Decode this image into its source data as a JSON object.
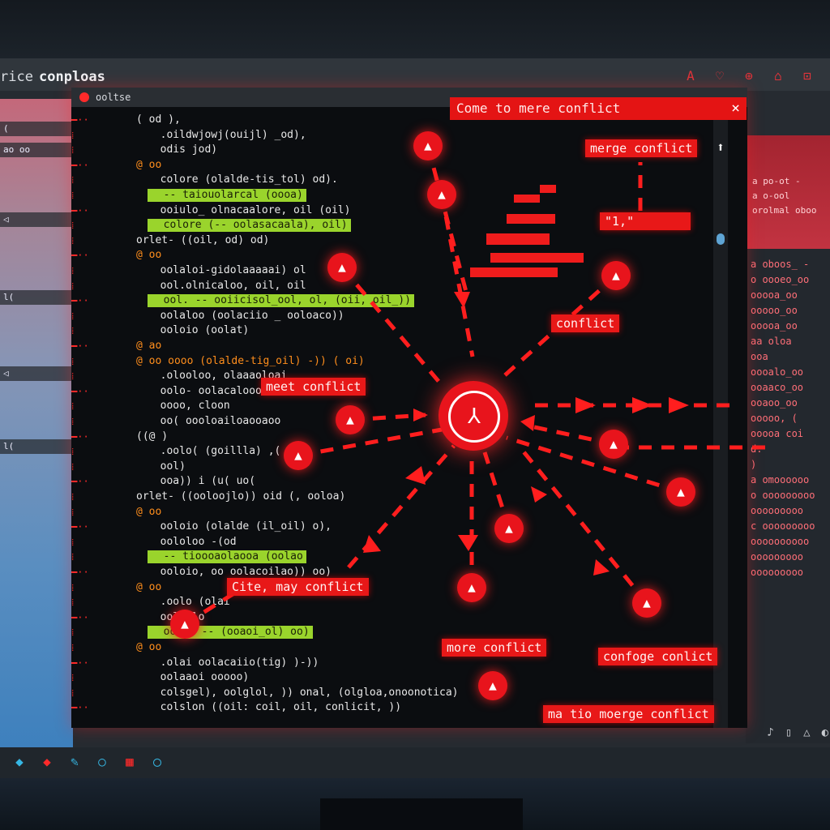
{
  "app": {
    "title_left": "rice",
    "title_main": "conploas"
  },
  "window_controls": [
    "A",
    "♡",
    "⊕",
    "⌂",
    "⊡"
  ],
  "editor": {
    "tab_title": "ooltse"
  },
  "banner": {
    "text": "Come to mere conflict",
    "close_label": "×"
  },
  "labels": {
    "merge_conflict_top": "merge conflict",
    "small_box": "\"1,\"",
    "conflict": "conflict",
    "meet_conflict": "meet conflict",
    "cite_conflict": "Cite, may conflict",
    "more_conflict": "more conflict",
    "confoge_conflict": "confoge conlict",
    "bottom_conflict": "ma tio moerge conflict"
  },
  "code_lines": [
    "( od ),",
    "  .oildwjowj(ouijl) _od),",
    "  odis jod)",
    "@ oo",
    "  colore (olalde-tis_tol) od).",
    "  -- taiouolarcal (oooa)",
    "  ooiulo_ olnacaalore, oil (oil)",
    "  colore (-- oolasacaala), oil)",
    "orlet- ((oil, od) od)",
    "@ oo",
    "  oolaloi-gidolaaaaai) ol",
    "  ool.olnicaloo, oil, oil",
    "  ool. -- ooiicisol_ool, ol, (oii, oil_))",
    "  oolaloo (oolaciio _ ooloaco))",
    "  ooloio (oolat)",
    "@ ao",
    "@ oo oooo (olalde-tig_oil) -)) ( oi)",
    "  .olooloo, olaaaoloai",
    "  oolo- oolacaloooa",
    "  oooo, cloon",
    "  oo( oooloailoaooaoo",
    "((@ )",
    "  .oolo( (goillla) ,(",
    "  ool)",
    "  ooa)) i (u( uo(",
    "orlet- ((ooloojlo)) oid (, ooloa)",
    "@ oo",
    "  ooloio (olalde (il_oil) o),",
    "  oololoo -(od",
    "  -- tioooaolaooa (oolao",
    "  ooloio, oo oolacoilao)) oo)",
    "@ oo",
    "  .oolo (olai",
    "  ooliolo",
    "  oolo- -- (ooaoi_ol) oo)",
    "@ oo",
    "  .olai oolacaiio(tig) )-))",
    "  oolaaoi ooooo)",
    "  colsgel), oolglol, )) onal, (olgloa,onoonotica)",
    "  colslon ((oil: coil, oil, conlicit, ))"
  ],
  "right_pane": {
    "top_lines": [
      "a po-ot -",
      "a o-ool",
      "orolmal oboo"
    ],
    "lines": [
      "a oboos_ -",
      "o oooeo_oo",
      "ooooa_oo",
      "ooooo_oo",
      "ooooa_oo",
      "aa oloa",
      "ooa",
      "oooalo_oo",
      "ooaaco_oo",
      "ooaoo_oo",
      "ooooo, (",
      "ooooa coi",
      "d.",
      ")",
      "a omoooooo",
      "o ooooooooo",
      "ooooooooo",
      "c ooooooooo",
      "oooooooooo",
      "ooooooooo",
      "ooooooooo"
    ]
  },
  "left_pane": {
    "rows": [
      "( ",
      "ao  oo",
      " ◁",
      "l(",
      "◁",
      "l("
    ]
  },
  "taskbar_icons": [
    "diamond-icon",
    "red-diamond-icon",
    "pencil-icon",
    "circle-icon",
    "calendar-icon",
    "ring-icon"
  ],
  "colors": {
    "accent_red": "#e8141c",
    "code_green": "#9ad42c",
    "bg_dark": "#0b0d10"
  }
}
